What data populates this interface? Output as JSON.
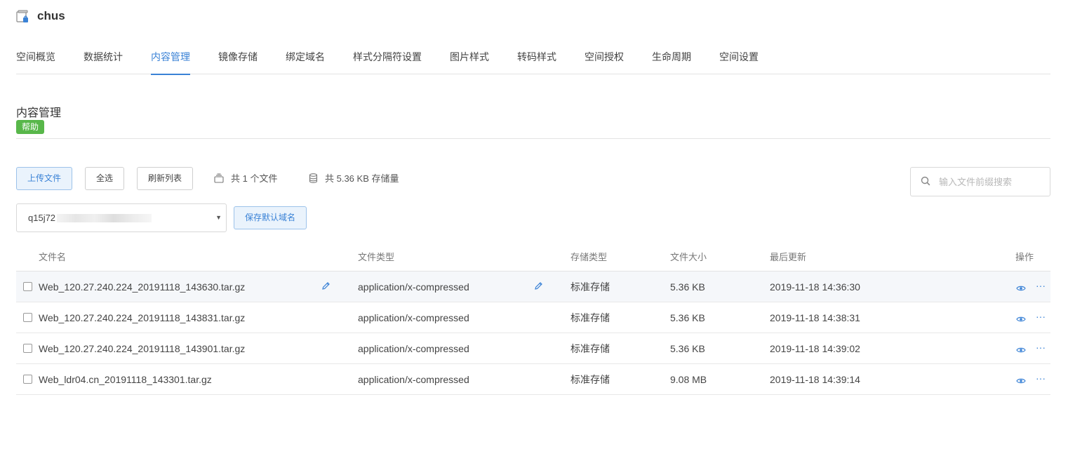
{
  "header": {
    "title": "chus",
    "icon": "bucket-icon"
  },
  "tabs": [
    {
      "label": "空间概览",
      "active": false
    },
    {
      "label": "数据统计",
      "active": false
    },
    {
      "label": "内容管理",
      "active": true
    },
    {
      "label": "镜像存储",
      "active": false
    },
    {
      "label": "绑定域名",
      "active": false
    },
    {
      "label": "样式分隔符设置",
      "active": false
    },
    {
      "label": "图片样式",
      "active": false
    },
    {
      "label": "转码样式",
      "active": false
    },
    {
      "label": "空间授权",
      "active": false
    },
    {
      "label": "生命周期",
      "active": false
    },
    {
      "label": "空间设置",
      "active": false
    }
  ],
  "section": {
    "title": "内容管理",
    "help_label": "帮助"
  },
  "toolbar": {
    "upload_label": "上传文件",
    "select_all_label": "全选",
    "refresh_label": "刷新列表",
    "file_count_text": "共 1 个文件",
    "storage_text": "共 5.36 KB 存储量",
    "search_placeholder": "输入文件前缀搜索"
  },
  "domain": {
    "value_visible": "q15j72",
    "save_default_label": "保存默认域名"
  },
  "table": {
    "columns": [
      "文件名",
      "文件类型",
      "存储类型",
      "文件大小",
      "最后更新",
      "操作"
    ],
    "rows": [
      {
        "name": "Web_120.27.240.224_20191118_143630.tar.gz",
        "type": "application/x-compressed",
        "storage": "标准存储",
        "size": "5.36 KB",
        "updated": "2019-11-18 14:36:30"
      },
      {
        "name": "Web_120.27.240.224_20191118_143831.tar.gz",
        "type": "application/x-compressed",
        "storage": "标准存储",
        "size": "5.36 KB",
        "updated": "2019-11-18 14:38:31"
      },
      {
        "name": "Web_120.27.240.224_20191118_143901.tar.gz",
        "type": "application/x-compressed",
        "storage": "标准存储",
        "size": "5.36 KB",
        "updated": "2019-11-18 14:39:02"
      },
      {
        "name": "Web_ldr04.cn_20191118_143301.tar.gz",
        "type": "application/x-compressed",
        "storage": "标准存储",
        "size": "9.08 MB",
        "updated": "2019-11-18 14:39:14"
      }
    ],
    "row_actions": {
      "preview_icon": "eye-icon",
      "more_label": "···"
    }
  },
  "colors": {
    "accent": "#3a82d6",
    "help_badge": "#58b74a",
    "row_highlight": "#f5f7fa"
  }
}
